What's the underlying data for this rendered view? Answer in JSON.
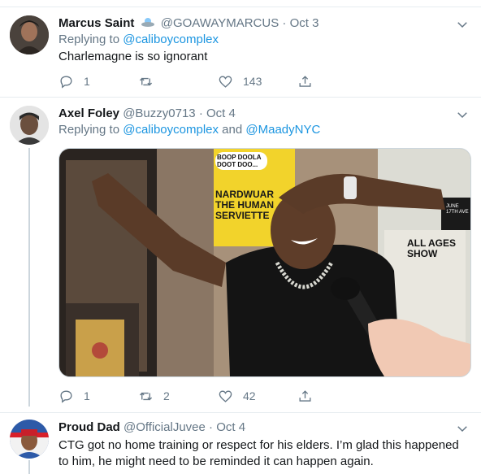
{
  "tweets": [
    {
      "name": "Marcus Saint",
      "handle": "@GOAWAYMARCUS",
      "separator": "·",
      "date": "Oct 3",
      "replying_prefix": "Replying to",
      "replying_to": "@caliboycomplex",
      "replying_join": "",
      "replying_to_2": "",
      "text": "Charlemagne is so ignorant",
      "replies": "1",
      "retweets": "",
      "likes": "143"
    },
    {
      "name": "Axel Foley",
      "handle": "@Buzzy0713",
      "separator": "·",
      "date": "Oct 4",
      "replying_prefix": "Replying to",
      "replying_to": "@caliboycomplex",
      "replying_join": "and",
      "replying_to_2": "@MaadyNYC",
      "text": "",
      "media_signs": {
        "sign1": "BOOP DOOLA DOOT DOO...",
        "sign2": "NARDWUAR THE HUMAN SERVIETTE",
        "sign3": "ALL AGES SHOW",
        "sign4": "JUNE 17TH AVE"
      },
      "replies": "1",
      "retweets": "2",
      "likes": "42"
    },
    {
      "name": "Proud Dad",
      "handle": "@OfficialJuvee",
      "separator": "·",
      "date": "Oct 4",
      "text": "CTG got no home training or respect for his elders. I’m glad this happened to him, he might need to be reminded it can happen again."
    }
  ],
  "icons": {
    "reply": "reply-icon",
    "retweet": "retweet-icon",
    "like": "heart-icon",
    "share": "share-icon",
    "more": "chevron-down-icon"
  },
  "colors": {
    "link": "#1b95e0",
    "secondary": "#657786",
    "divider": "#e6ecf0"
  }
}
